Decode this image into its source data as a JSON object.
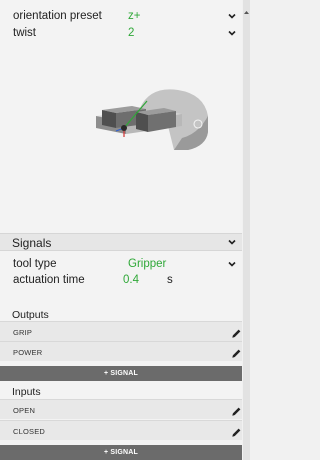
{
  "orientation": {
    "label": "orientation preset",
    "value": "z+"
  },
  "twist": {
    "label": "twist",
    "value": "2"
  },
  "signals": {
    "title": "Signals",
    "tool_type": {
      "label": "tool type",
      "value": "Gripper"
    },
    "actuation_time": {
      "label": "actuation time",
      "value": "0.4",
      "unit": "s"
    },
    "outputs": {
      "title": "Outputs",
      "items": [
        {
          "label": "GRIP"
        },
        {
          "label": "POWER"
        }
      ],
      "add_label": "+ SIGNAL"
    },
    "inputs": {
      "title": "Inputs",
      "items": [
        {
          "label": "OPEN"
        },
        {
          "label": "CLOSED"
        }
      ],
      "add_label": "+ SIGNAL"
    }
  },
  "colors": {
    "accent": "#2fa838",
    "add_button": "#6b6b6b",
    "axis_x": "#d23030",
    "axis_y": "#2fa838",
    "axis_z": "#2f5fd0"
  }
}
